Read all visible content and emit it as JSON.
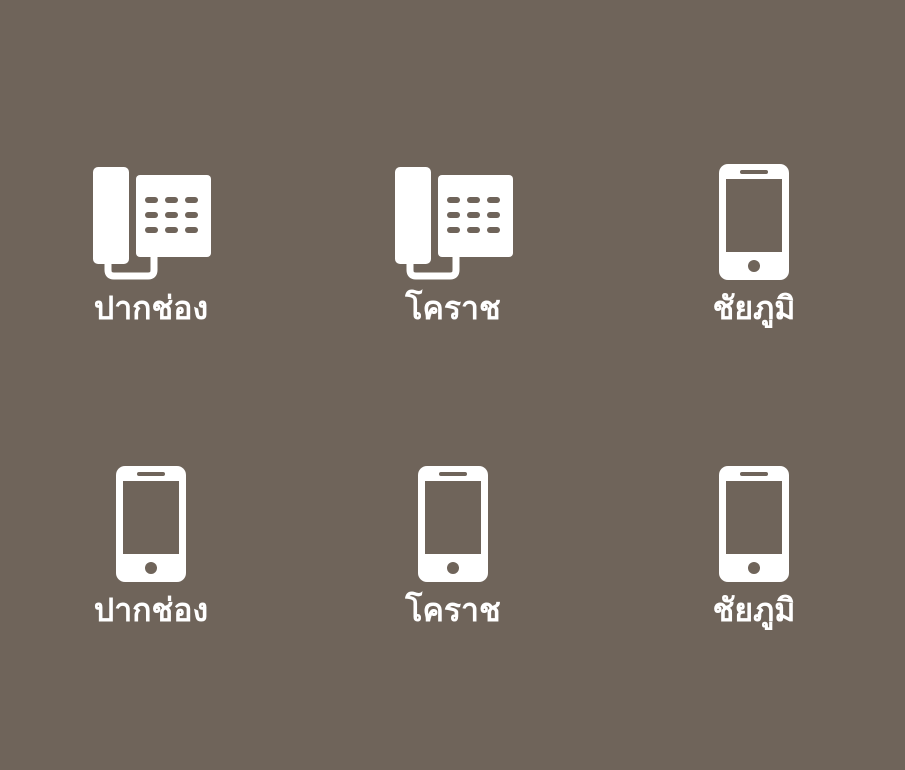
{
  "colors": {
    "background": "#6f645a",
    "icon": "#ffffff"
  },
  "contacts": [
    {
      "label": "ปากช่อง",
      "icon": "desk-phone-icon"
    },
    {
      "label": "โคราช",
      "icon": "desk-phone-icon"
    },
    {
      "label": "ชัยภูมิ",
      "icon": "mobile-phone-icon"
    },
    {
      "label": "ปากช่อง",
      "icon": "mobile-phone-icon"
    },
    {
      "label": "โคราช",
      "icon": "mobile-phone-icon"
    },
    {
      "label": "ชัยภูมิ",
      "icon": "mobile-phone-icon"
    }
  ]
}
